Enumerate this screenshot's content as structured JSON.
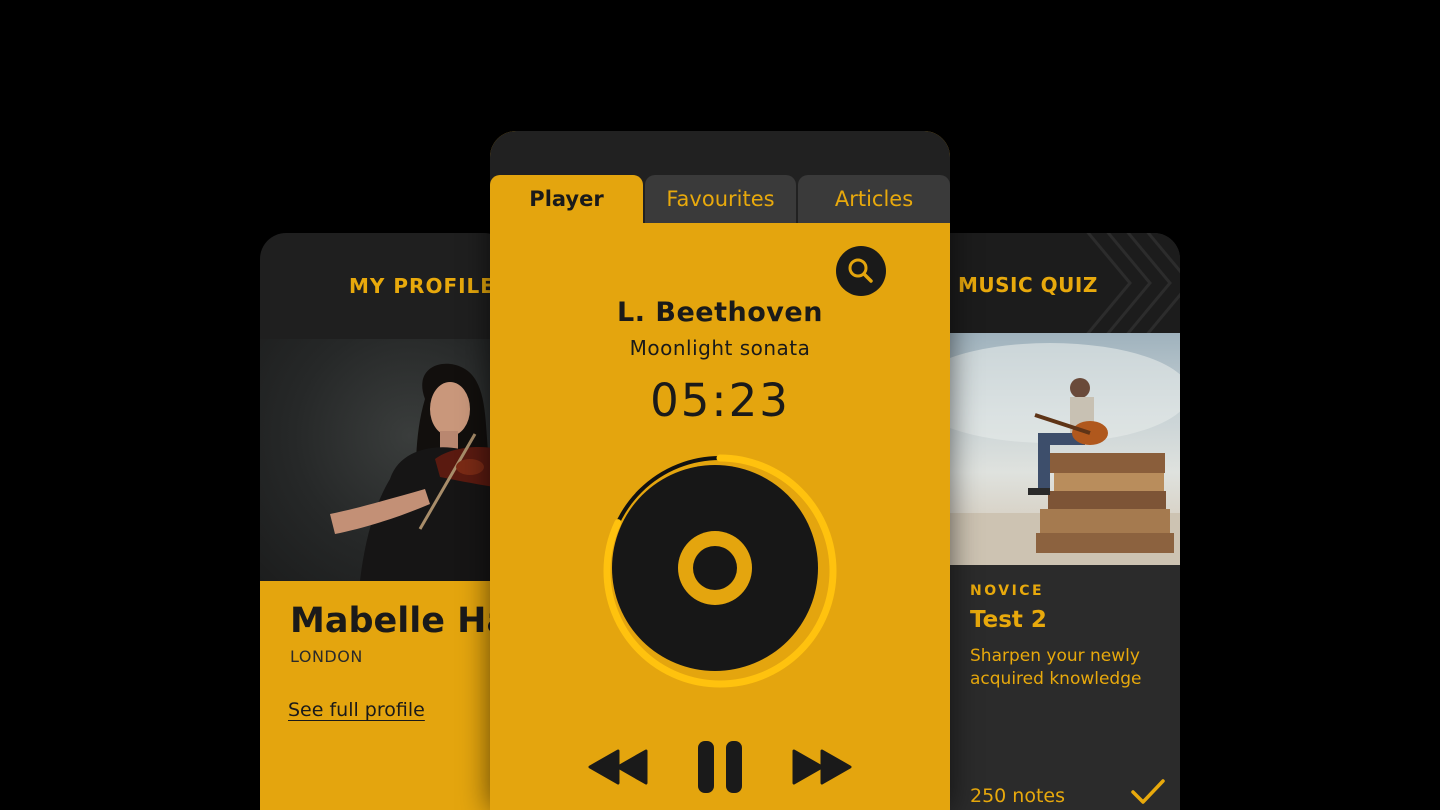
{
  "profile_card": {
    "header": "MY PROFILE",
    "name": "Mabelle Hale",
    "city": "LONDON",
    "link": "See full profile"
  },
  "player": {
    "tabs": [
      {
        "label": "Player",
        "active": true
      },
      {
        "label": "Favourites",
        "active": false
      },
      {
        "label": "Articles",
        "active": false
      }
    ],
    "artist": "L. Beethoven",
    "track": "Moonlight sonata",
    "time": "05:23",
    "progress": 0.82,
    "icons": {
      "search": "search-icon",
      "rewind": "rewind-icon",
      "pause": "pause-icon",
      "forward": "fast-forward-icon"
    }
  },
  "quiz_card": {
    "header": "MUSIC QUIZ",
    "level": "NOVICE",
    "title": "Test 2",
    "description": "Sharpen your newly acquired knowledge",
    "notes": "250 notes"
  },
  "colors": {
    "accent": "#e4a50e",
    "dark": "#1a1a1a",
    "ring": "#ffc20e"
  }
}
